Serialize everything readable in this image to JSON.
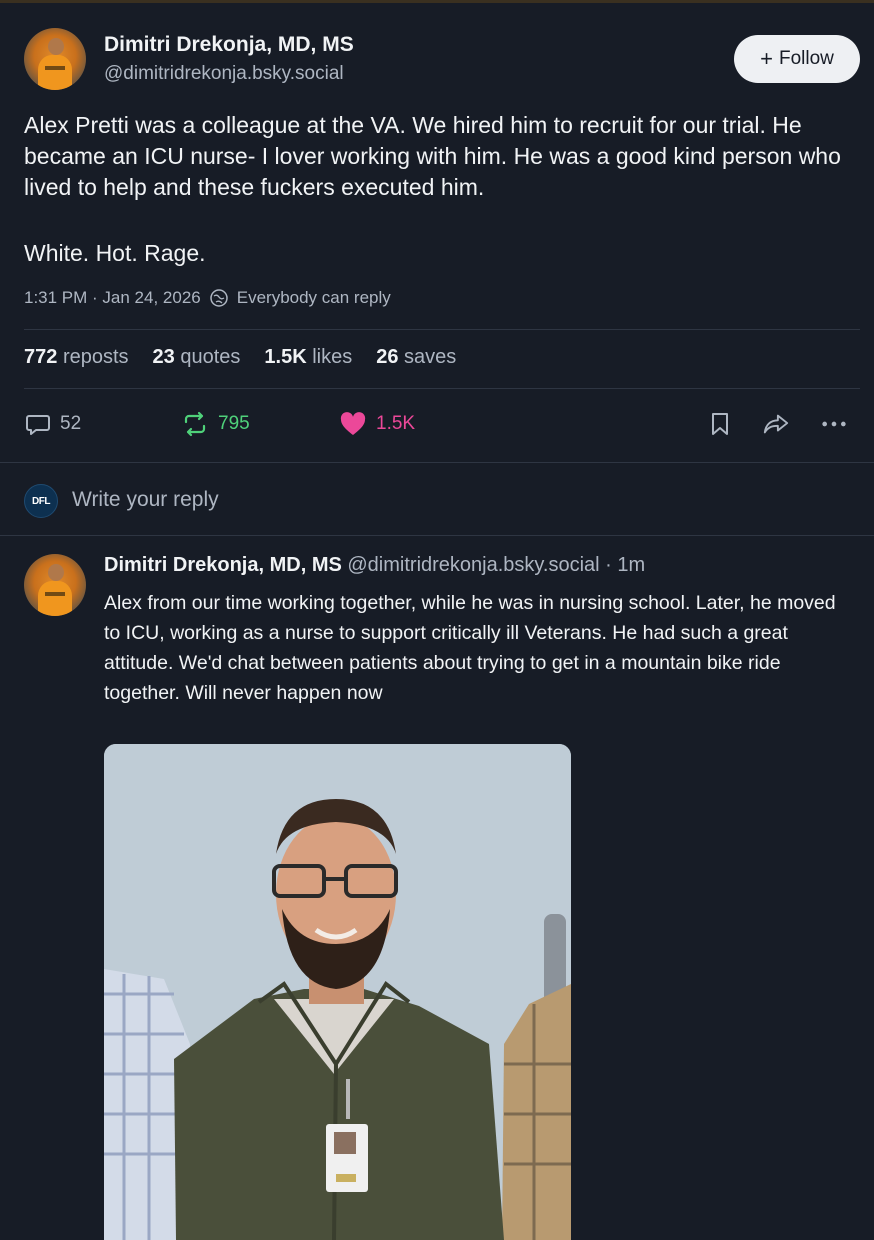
{
  "post": {
    "author_name": "Dimitri Drekonja, MD, MS",
    "author_handle": "@dimitridrekonja.bsky.social",
    "follow_label": "Follow",
    "text": "Alex Pretti was a colleague at the VA. We hired him to recruit for our trial. He became an ICU nurse- I lover working with him. He was a good kind person who lived to help and these fuckers executed him.",
    "text2": "White. Hot. Rage.",
    "timestamp": "1:31 PM · Jan 24, 2026",
    "reply_setting": "Everybody can reply",
    "stats": {
      "reposts_count": "772",
      "reposts_label": "reposts",
      "quotes_count": "23",
      "quotes_label": "quotes",
      "likes_count": "1.5K",
      "likes_label": "likes",
      "saves_count": "26",
      "saves_label": "saves"
    },
    "actions": {
      "reply_count": "52",
      "repost_count": "795",
      "like_count": "1.5K"
    }
  },
  "composer": {
    "avatar_text": "DFL",
    "placeholder": "Write your reply"
  },
  "reply": {
    "author_name": "Dimitri Drekonja, MD, MS",
    "author_handle_time": "@dimitridrekonja.bsky.social · 1m",
    "text": "Alex from our time working together, while he was in nursing school. Later, he moved to ICU, working as a nurse to support critically ill Veterans. He had such a great attitude. We'd chat between patients about trying to get in a mountain bike ride together. Will never happen now"
  },
  "colors": {
    "background": "#171c26",
    "repost_active": "#4fd17a",
    "like_active": "#ec4899",
    "muted": "#aeb6c2"
  }
}
